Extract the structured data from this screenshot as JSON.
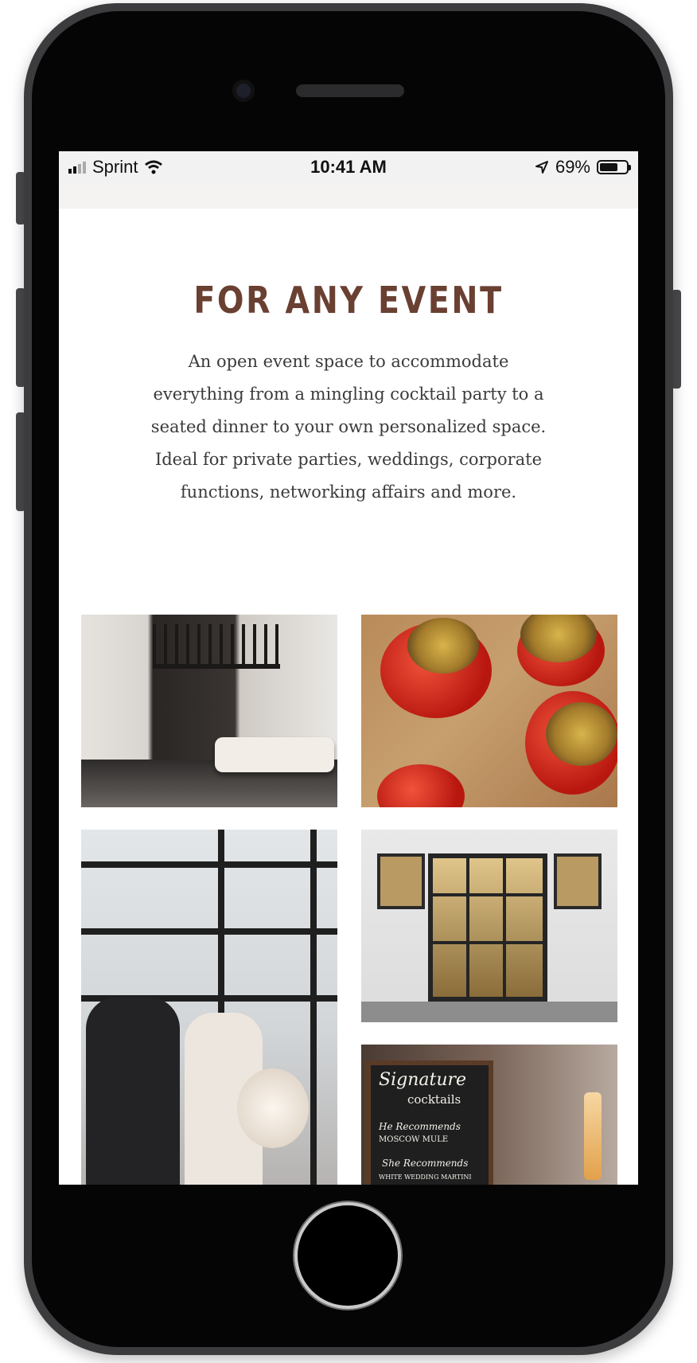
{
  "status_bar": {
    "carrier": "Sprint",
    "time": "10:41 AM",
    "battery": "69%",
    "battery_level": 0.69,
    "icons": [
      "signal-icon",
      "wifi-icon",
      "location-arrow-icon",
      "battery-icon"
    ]
  },
  "content": {
    "headline": "FOR ANY EVENT",
    "description": "An open event space to accommodate everything from a mingling cocktail party to a seated dinner to your own personalized space. Ideal for private parties, weddings, corporate functions, networking affairs and more."
  },
  "chalkboard": {
    "title_1": "Signature",
    "title_2": "cocktails",
    "line_1": "He Recommends",
    "line_2": "MOSCOW MULE",
    "line_3": "She Recommends",
    "line_4": "WHITE WEDDING MARTINI"
  },
  "colors": {
    "headline": "#6a4032",
    "body_text": "#3b3b3b",
    "phone_frame": "#3c3c3f"
  }
}
